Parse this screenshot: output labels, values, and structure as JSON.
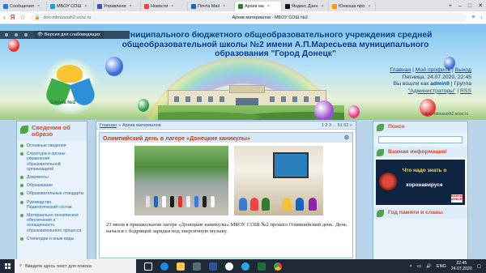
{
  "browser": {
    "tabs": [
      {
        "label": "Сообщения",
        "color": "#2b78e4",
        "active": false
      },
      {
        "label": "МБОУ СОШ",
        "color": "#1e9ad6",
        "active": false
      },
      {
        "label": "Управлени",
        "color": "#3f51b5",
        "active": false
      },
      {
        "label": "Новости",
        "color": "#f44336",
        "active": false
      },
      {
        "label": "Почта Mail",
        "color": "#1565c0",
        "active": false
      },
      {
        "label": "Архив ма",
        "color": "#2e7d32",
        "active": true
      },
      {
        "label": "Яндекс Дзен",
        "color": "#111111",
        "active": false
      },
      {
        "label": "Юнкошa про",
        "color": "#ff9800",
        "active": false
      }
    ],
    "url_host": "don-mbousosh2.ucoz.ru",
    "page_title": "Архив материалов - МБОУ СОШ №2"
  },
  "ucoz_panel": {
    "visually_impaired_label": "Версия для слабовидящих"
  },
  "header": {
    "school_name": "Муниципального бюджетного общеобразовательного учреждения средней общеобразовательной школы №2 имени А.П.Маресьева муниципального образования \"Город Донецк\"",
    "logo_text": "Школа №2",
    "user_links": {
      "home": "Главная",
      "profile": "Мой профиль",
      "logout": "Выход",
      "date_line": "Пятница, 24.07.2020, 22:45",
      "logged_in_as": "Вы вошли как",
      "username": "admin9",
      "group_label": "Группа",
      "group": "\"Администраторы\"",
      "rss": "RSS"
    },
    "watermark": "don-mbousosh2.ucoz.ru"
  },
  "left_menu": {
    "title": "Сведения об образо",
    "items": [
      "Основные сведения",
      "Структура и органы управления образовательной организацией",
      "Документы",
      "Образование",
      "Образовательные стандарты",
      "Руководство. Педагогический состав",
      "Материально-техническое обеспечение и оснащенность образовательного процесса",
      "Стипендии и иные виды"
    ]
  },
  "content": {
    "breadcrumb_home": "Главная",
    "breadcrumb_sep": "»",
    "breadcrumb_current": "Архив материалов",
    "pager": "1 2 3 ... 51 52 »",
    "post_title": "Олимпийский день в лагере «Донецкие каникулы»",
    "post_text": "23 июля в пришкольном лагере «Донецкие каникулы» МБОУ СОШ №2 прошёл Олимпийский день. День начался с бодрящей зарядки под энергичную музыку."
  },
  "right_col": {
    "search_title": "Поиск",
    "info_title": "Важная информация!",
    "corona_line1": "Что надо знать о",
    "corona_line2": "коронавирусе",
    "corona_badge": "ВАЖНАЯ ИНФОРМАЦИЯ",
    "memory_title": "Год памяти и славы"
  },
  "taskbar": {
    "search_placeholder": "Введите здесь текст для поиска",
    "lang": "ENG",
    "time": "22:45",
    "date": "24.07.2020"
  }
}
